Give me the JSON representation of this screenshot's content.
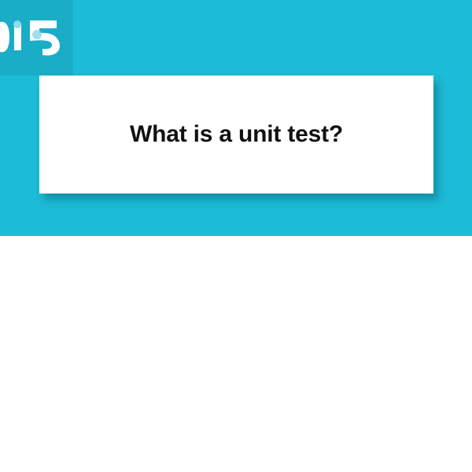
{
  "logo": {
    "icon": "fifteen-logo-icon",
    "color_tile": "#19adc7",
    "color_glyph": "#ffffff",
    "color_accent": "#8fdbea"
  },
  "header": {
    "background": "#1cbbd6"
  },
  "card": {
    "question": "What is a unit test?"
  }
}
